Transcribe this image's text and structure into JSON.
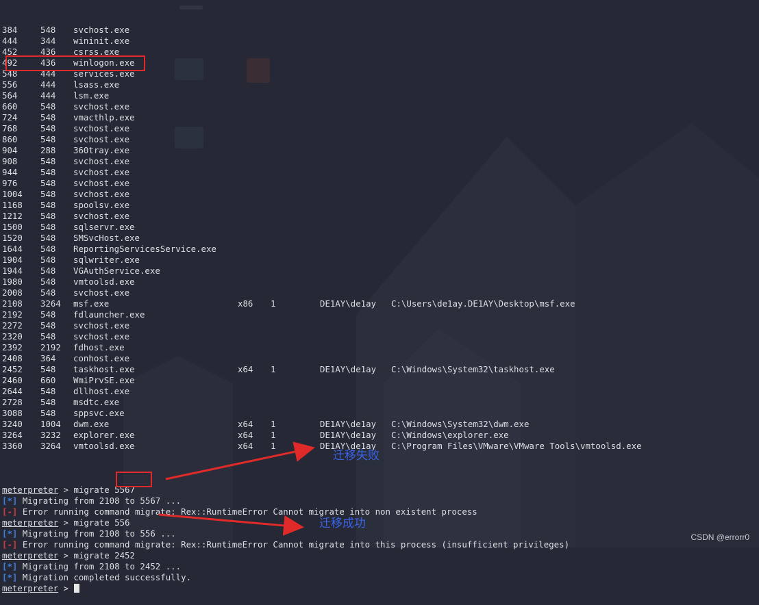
{
  "processes": [
    {
      "pid": "384",
      "ppid": "548",
      "name": "svchost.exe",
      "arch": "",
      "session": "",
      "user": "",
      "path": ""
    },
    {
      "pid": "444",
      "ppid": "344",
      "name": "wininit.exe",
      "arch": "",
      "session": "",
      "user": "",
      "path": ""
    },
    {
      "pid": "452",
      "ppid": "436",
      "name": "csrss.exe",
      "arch": "",
      "session": "",
      "user": "",
      "path": ""
    },
    {
      "pid": "492",
      "ppid": "436",
      "name": "winlogon.exe",
      "arch": "",
      "session": "",
      "user": "",
      "path": ""
    },
    {
      "pid": "548",
      "ppid": "444",
      "name": "services.exe",
      "arch": "",
      "session": "",
      "user": "",
      "path": ""
    },
    {
      "pid": "556",
      "ppid": "444",
      "name": "lsass.exe",
      "arch": "",
      "session": "",
      "user": "",
      "path": ""
    },
    {
      "pid": "564",
      "ppid": "444",
      "name": "lsm.exe",
      "arch": "",
      "session": "",
      "user": "",
      "path": ""
    },
    {
      "pid": "660",
      "ppid": "548",
      "name": "svchost.exe",
      "arch": "",
      "session": "",
      "user": "",
      "path": ""
    },
    {
      "pid": "724",
      "ppid": "548",
      "name": "vmacthlp.exe",
      "arch": "",
      "session": "",
      "user": "",
      "path": ""
    },
    {
      "pid": "768",
      "ppid": "548",
      "name": "svchost.exe",
      "arch": "",
      "session": "",
      "user": "",
      "path": ""
    },
    {
      "pid": "860",
      "ppid": "548",
      "name": "svchost.exe",
      "arch": "",
      "session": "",
      "user": "",
      "path": ""
    },
    {
      "pid": "904",
      "ppid": "288",
      "name": "360tray.exe",
      "arch": "",
      "session": "",
      "user": "",
      "path": ""
    },
    {
      "pid": "908",
      "ppid": "548",
      "name": "svchost.exe",
      "arch": "",
      "session": "",
      "user": "",
      "path": ""
    },
    {
      "pid": "944",
      "ppid": "548",
      "name": "svchost.exe",
      "arch": "",
      "session": "",
      "user": "",
      "path": ""
    },
    {
      "pid": "976",
      "ppid": "548",
      "name": "svchost.exe",
      "arch": "",
      "session": "",
      "user": "",
      "path": ""
    },
    {
      "pid": "1004",
      "ppid": "548",
      "name": "svchost.exe",
      "arch": "",
      "session": "",
      "user": "",
      "path": ""
    },
    {
      "pid": "1168",
      "ppid": "548",
      "name": "spoolsv.exe",
      "arch": "",
      "session": "",
      "user": "",
      "path": ""
    },
    {
      "pid": "1212",
      "ppid": "548",
      "name": "svchost.exe",
      "arch": "",
      "session": "",
      "user": "",
      "path": ""
    },
    {
      "pid": "1500",
      "ppid": "548",
      "name": "sqlservr.exe",
      "arch": "",
      "session": "",
      "user": "",
      "path": ""
    },
    {
      "pid": "1520",
      "ppid": "548",
      "name": "SMSvcHost.exe",
      "arch": "",
      "session": "",
      "user": "",
      "path": ""
    },
    {
      "pid": "1644",
      "ppid": "548",
      "name": "ReportingServicesService.exe",
      "arch": "",
      "session": "",
      "user": "",
      "path": ""
    },
    {
      "pid": "1904",
      "ppid": "548",
      "name": "sqlwriter.exe",
      "arch": "",
      "session": "",
      "user": "",
      "path": ""
    },
    {
      "pid": "1944",
      "ppid": "548",
      "name": "VGAuthService.exe",
      "arch": "",
      "session": "",
      "user": "",
      "path": ""
    },
    {
      "pid": "1980",
      "ppid": "548",
      "name": "vmtoolsd.exe",
      "arch": "",
      "session": "",
      "user": "",
      "path": ""
    },
    {
      "pid": "2008",
      "ppid": "548",
      "name": "svchost.exe",
      "arch": "",
      "session": "",
      "user": "",
      "path": ""
    },
    {
      "pid": "2108",
      "ppid": "3264",
      "name": "msf.exe",
      "arch": "x86",
      "session": "1",
      "user": "DE1AY\\de1ay",
      "path": "C:\\Users\\de1ay.DE1AY\\Desktop\\msf.exe"
    },
    {
      "pid": "2192",
      "ppid": "548",
      "name": "fdlauncher.exe",
      "arch": "",
      "session": "",
      "user": "",
      "path": ""
    },
    {
      "pid": "2272",
      "ppid": "548",
      "name": "svchost.exe",
      "arch": "",
      "session": "",
      "user": "",
      "path": ""
    },
    {
      "pid": "2320",
      "ppid": "548",
      "name": "svchost.exe",
      "arch": "",
      "session": "",
      "user": "",
      "path": ""
    },
    {
      "pid": "2392",
      "ppid": "2192",
      "name": "fdhost.exe",
      "arch": "",
      "session": "",
      "user": "",
      "path": ""
    },
    {
      "pid": "2408",
      "ppid": "364",
      "name": "conhost.exe",
      "arch": "",
      "session": "",
      "user": "",
      "path": ""
    },
    {
      "pid": "2452",
      "ppid": "548",
      "name": "taskhost.exe",
      "arch": "x64",
      "session": "1",
      "user": "DE1AY\\de1ay",
      "path": "C:\\Windows\\System32\\taskhost.exe"
    },
    {
      "pid": "2460",
      "ppid": "660",
      "name": "WmiPrvSE.exe",
      "arch": "",
      "session": "",
      "user": "",
      "path": ""
    },
    {
      "pid": "2644",
      "ppid": "548",
      "name": "dllhost.exe",
      "arch": "",
      "session": "",
      "user": "",
      "path": ""
    },
    {
      "pid": "2728",
      "ppid": "548",
      "name": "msdtc.exe",
      "arch": "",
      "session": "",
      "user": "",
      "path": ""
    },
    {
      "pid": "3088",
      "ppid": "548",
      "name": "sppsvc.exe",
      "arch": "",
      "session": "",
      "user": "",
      "path": ""
    },
    {
      "pid": "3240",
      "ppid": "1004",
      "name": "dwm.exe",
      "arch": "x64",
      "session": "1",
      "user": "DE1AY\\de1ay",
      "path": "C:\\Windows\\System32\\dwm.exe"
    },
    {
      "pid": "3264",
      "ppid": "3232",
      "name": "explorer.exe",
      "arch": "x64",
      "session": "1",
      "user": "DE1AY\\de1ay",
      "path": "C:\\Windows\\explorer.exe"
    },
    {
      "pid": "3360",
      "ppid": "3264",
      "name": "vmtoolsd.exe",
      "arch": "x64",
      "session": "1",
      "user": "DE1AY\\de1ay",
      "path": "C:\\Program Files\\VMware\\VMware Tools\\vmtoolsd.exe"
    }
  ],
  "console": [
    {
      "kind": "prompt",
      "prompt": "meterpreter",
      "text": " > migrate 5567"
    },
    {
      "kind": "info",
      "tag": "[*]",
      "text": " Migrating from 2108 to 5567 ..."
    },
    {
      "kind": "error",
      "tag": "[-]",
      "text": " Error running command migrate: Rex::RuntimeError Cannot migrate into non existent process"
    },
    {
      "kind": "prompt",
      "prompt": "meterpreter",
      "text": " > migrate 556"
    },
    {
      "kind": "info",
      "tag": "[*]",
      "text": " Migrating from 2108 to 556 ..."
    },
    {
      "kind": "error",
      "tag": "[-]",
      "text": " Error running command migrate: Rex::RuntimeError Cannot migrate into this process (insufficient privileges)"
    },
    {
      "kind": "prompt",
      "prompt": "meterpreter",
      "text": " > migrate 2452"
    },
    {
      "kind": "info",
      "tag": "[*]",
      "text": " Migrating from 2108 to 2452 ..."
    },
    {
      "kind": "info",
      "tag": "[*]",
      "text": " Migration completed successfully."
    },
    {
      "kind": "cursor",
      "prompt": "meterpreter",
      "text": " > "
    }
  ],
  "annotations": {
    "fail_label": "迁移失败",
    "success_label": "迁移成功",
    "color": "#e02a2a",
    "label_color": "#3b63e6"
  },
  "watermark": "CSDN @errorr0"
}
